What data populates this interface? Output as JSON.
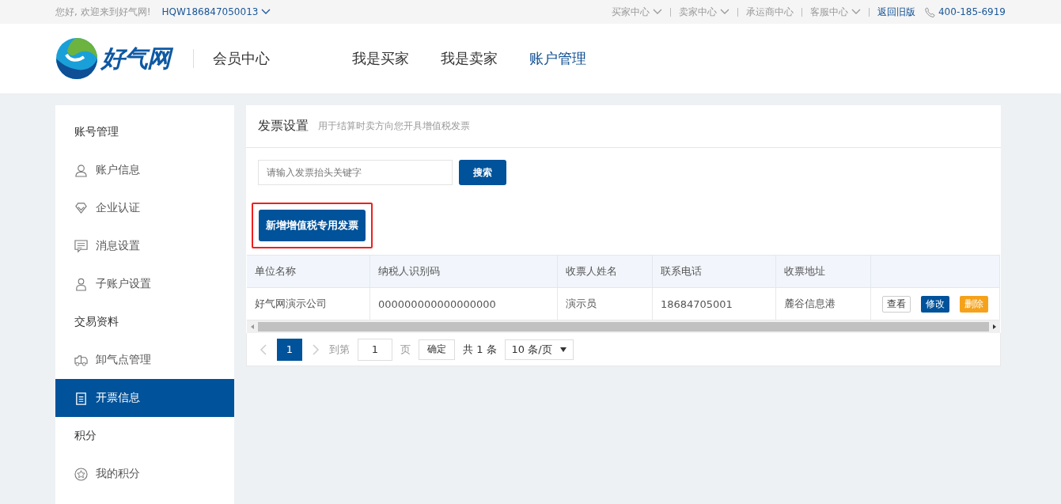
{
  "top_bar": {
    "greeting": "您好, 欢迎来到好气网!",
    "username": {
      "label": "HQW186847050013",
      "dropdown": true
    },
    "links": [
      {
        "label": "买家中心",
        "dropdown": true,
        "kind": "plain"
      },
      {
        "label": "卖家中心",
        "dropdown": true,
        "kind": "plain"
      },
      {
        "label": "承运商中心",
        "dropdown": false,
        "kind": "plain"
      },
      {
        "label": "客服中心",
        "dropdown": true,
        "kind": "plain"
      },
      {
        "label": "返回旧版",
        "dropdown": false,
        "kind": "highlight"
      }
    ],
    "phone": "400-185-6919"
  },
  "header": {
    "logo_text": "好气网",
    "section_title": "会员中心",
    "nav": [
      {
        "label": "我是买家",
        "selected": false
      },
      {
        "label": "我是卖家",
        "selected": false
      },
      {
        "label": "账户管理",
        "selected": true
      }
    ]
  },
  "sidebar": [
    {
      "title": "账号管理",
      "items": [
        {
          "label": "账户信息",
          "selected": false
        },
        {
          "label": "企业认证",
          "selected": false
        },
        {
          "label": "消息设置",
          "selected": false
        },
        {
          "label": "子账户设置",
          "selected": false
        }
      ]
    },
    {
      "title": "交易资料",
      "items": [
        {
          "label": "卸气点管理",
          "selected": false
        },
        {
          "label": "开票信息",
          "selected": true
        }
      ]
    },
    {
      "title": "积分",
      "items": [
        {
          "label": "我的积分",
          "selected": false
        }
      ]
    }
  ],
  "panel": {
    "title": "发票设置",
    "subtitle": "用于结算时卖方向您开具增值税发票",
    "search": {
      "placeholder": "请输入发票抬头关键字",
      "button": "搜索"
    },
    "add_button": {
      "label": "新增增值税专用发票",
      "highlighted": true
    },
    "table": {
      "columns": [
        "单位名称",
        "纳税人识别码",
        "收票人姓名",
        "联系电话",
        "收票地址"
      ],
      "rows": [
        {
          "cells": [
            "好气网演示公司",
            "000000000000000000",
            "演示员",
            "18684705001",
            "麓谷信息港"
          ],
          "actions": [
            {
              "label": "查看",
              "kind": "outline"
            },
            {
              "label": "修改",
              "kind": "primary"
            },
            {
              "label": "删除",
              "kind": "warning"
            }
          ]
        }
      ]
    },
    "pagination": {
      "pages": [
        {
          "label": "1",
          "selected": true
        }
      ],
      "goto_label": "到第",
      "goto_value": "1",
      "page_unit": "页",
      "confirm": "确定",
      "total": "共 1 条",
      "page_size": "10 条/页"
    }
  }
}
